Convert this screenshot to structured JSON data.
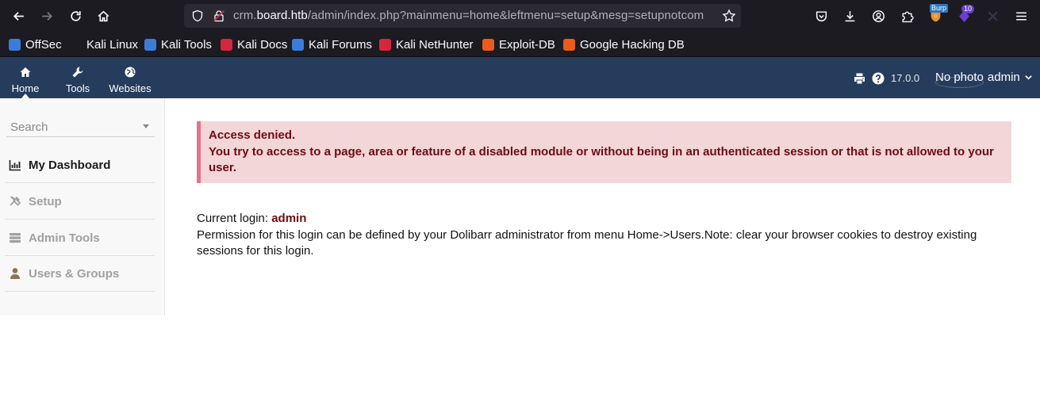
{
  "browser": {
    "url": {
      "prefix": "crm.",
      "domain": "board.htb",
      "path": "/admin/index.php?mainmenu=home&leftmenu=setup&mesg=setupnotcom"
    },
    "extensions": {
      "burp_label": "Burp",
      "badge_count": "10"
    },
    "bookmarks": [
      {
        "label": "OffSec",
        "color": "#3d7bd9"
      },
      {
        "label": "Kali Linux",
        "color": "#1c1b22"
      },
      {
        "label": "Kali Tools",
        "color": "#3d7bd9"
      },
      {
        "label": "Kali Docs",
        "color": "#d6263e"
      },
      {
        "label": "Kali Forums",
        "color": "#3d7bd9"
      },
      {
        "label": "Kali NetHunter",
        "color": "#d6263e"
      },
      {
        "label": "Exploit-DB",
        "color": "#ea5c1b"
      },
      {
        "label": "Google Hacking DB",
        "color": "#ea5c1b"
      }
    ]
  },
  "topbar": {
    "menus": [
      {
        "label": "Home",
        "icon": "home-icon"
      },
      {
        "label": "Tools",
        "icon": "wrench-icon"
      },
      {
        "label": "Websites",
        "icon": "globe-icon"
      }
    ],
    "version": "17.0.0",
    "user": {
      "nophoto": "No photo",
      "name": "admin"
    },
    "color": "#263c5c"
  },
  "sidebar": {
    "search_placeholder": "Search",
    "items": [
      {
        "label": "My Dashboard",
        "icon": "chart-icon",
        "state": "active"
      },
      {
        "label": "Setup",
        "icon": "tools-icon",
        "state": "disabled"
      },
      {
        "label": "Admin Tools",
        "icon": "server-icon",
        "state": "disabled"
      },
      {
        "label": "Users & Groups",
        "icon": "user-icon",
        "state": "disabled"
      }
    ]
  },
  "main": {
    "alert": {
      "title": "Access denied.",
      "message": "You try to access to a page, area or feature of a disabled module or without being in an authenticated session or that is not allowed to your user."
    },
    "login": {
      "label": "Current login: ",
      "name": "admin",
      "permission_note": "Permission for this login can be defined by your Dolibarr administrator from menu Home->Users.Note: clear your browser cookies to destroy existing sessions for this login."
    }
  }
}
